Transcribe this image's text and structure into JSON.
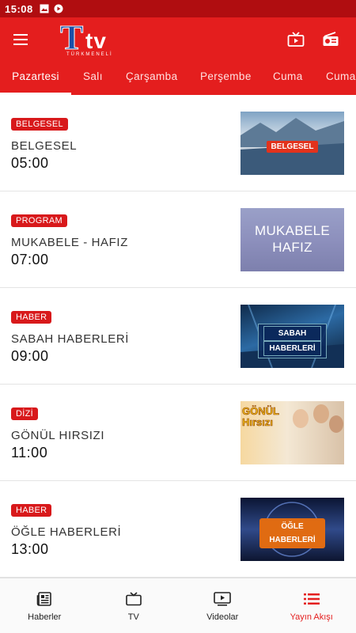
{
  "status_bar": {
    "time": "15:08"
  },
  "app": {
    "logo_main": "T",
    "logo_tv": "tv",
    "logo_sub": "TÜRKMENELİ"
  },
  "tabs": [
    {
      "label": "Pazartesi",
      "active": true
    },
    {
      "label": "Salı"
    },
    {
      "label": "Çarşamba"
    },
    {
      "label": "Perşembe"
    },
    {
      "label": "Cuma"
    },
    {
      "label": "Cumar"
    }
  ],
  "programs": [
    {
      "badge": "BELGESEL",
      "title": "BELGESEL",
      "time": "05:00",
      "thumb_caption": "BELGESEL"
    },
    {
      "badge": "PROGRAM",
      "title": "MUKABELE - HAFIZ",
      "time": "07:00",
      "thumb_caption_line1": "MUKABELE",
      "thumb_caption_line2": "HAFIZ"
    },
    {
      "badge": "HABER",
      "title": "SABAH HABERLERİ",
      "time": "09:00",
      "thumb_caption_line1": "SABAH",
      "thumb_caption_line2": "HABERLERİ"
    },
    {
      "badge": "DİZİ",
      "title": "GÖNÜL HIRSIZI",
      "time": "11:00",
      "thumb_caption_line1": "GÖNÜL",
      "thumb_caption_line2": "Hırsızı"
    },
    {
      "badge": "HABER",
      "title": "ÖĞLE HABERLERİ",
      "time": "13:00",
      "thumb_caption_line1": "ÖĞLE",
      "thumb_caption_line2": "HABERLERİ"
    }
  ],
  "bottom_nav": [
    {
      "label": "Haberler",
      "icon": "newspaper-icon"
    },
    {
      "label": "TV",
      "icon": "tv-icon"
    },
    {
      "label": "Videolar",
      "icon": "video-play-icon"
    },
    {
      "label": "Yayın Akışı",
      "icon": "list-icon",
      "active": true
    }
  ],
  "colors": {
    "primary": "#e41e1e",
    "status_bar": "#b00d10",
    "badge": "#d8191b"
  }
}
